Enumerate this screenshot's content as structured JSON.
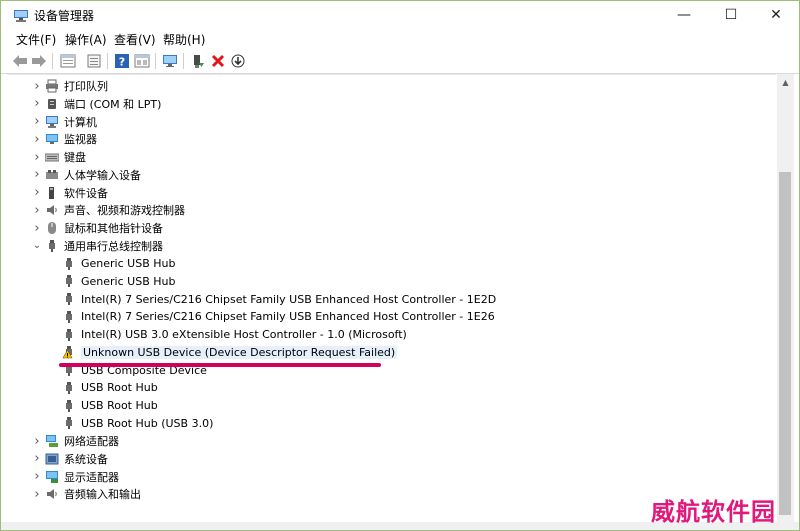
{
  "window": {
    "title": "设备管理器"
  },
  "winbuttons": {
    "minimize": "—",
    "maximize": "☐",
    "close": "✕"
  },
  "menu": [
    {
      "label": "文件(F)"
    },
    {
      "label": "操作(A)"
    },
    {
      "label": "查看(V)"
    },
    {
      "label": "帮助(H)"
    }
  ],
  "tree": [
    {
      "label": "打印队列",
      "icon": "printer-icon",
      "level": 0,
      "expander": "collapsed"
    },
    {
      "label": "端口 (COM 和 LPT)",
      "icon": "port-icon",
      "level": 0,
      "expander": "collapsed"
    },
    {
      "label": "计算机",
      "icon": "computer-icon",
      "level": 0,
      "expander": "collapsed"
    },
    {
      "label": "监视器",
      "icon": "monitor-icon",
      "level": 0,
      "expander": "collapsed"
    },
    {
      "label": "键盘",
      "icon": "keyboard-icon",
      "level": 0,
      "expander": "collapsed"
    },
    {
      "label": "人体学输入设备",
      "icon": "hid-icon",
      "level": 0,
      "expander": "collapsed"
    },
    {
      "label": "软件设备",
      "icon": "software-device-icon",
      "level": 0,
      "expander": "collapsed"
    },
    {
      "label": "声音、视频和游戏控制器",
      "icon": "speaker-icon",
      "level": 0,
      "expander": "collapsed"
    },
    {
      "label": "鼠标和其他指针设备",
      "icon": "mouse-icon",
      "level": 0,
      "expander": "collapsed"
    },
    {
      "label": "通用串行总线控制器",
      "icon": "usb-icon",
      "level": 0,
      "expander": "expanded"
    },
    {
      "label": "Generic USB Hub",
      "icon": "usb-icon",
      "level": 1
    },
    {
      "label": "Generic USB Hub",
      "icon": "usb-icon",
      "level": 1
    },
    {
      "label": "Intel(R) 7 Series/C216 Chipset Family USB Enhanced Host Controller - 1E2D",
      "icon": "usb-icon",
      "level": 1
    },
    {
      "label": "Intel(R) 7 Series/C216 Chipset Family USB Enhanced Host Controller - 1E26",
      "icon": "usb-icon",
      "level": 1
    },
    {
      "label": "Intel(R) USB 3.0 eXtensible Host Controller - 1.0 (Microsoft)",
      "icon": "usb-icon",
      "level": 1
    },
    {
      "label": "Unknown USB Device (Device Descriptor Request Failed)",
      "icon": "warning-icon",
      "level": 1,
      "selected": true
    },
    {
      "label": "USB Composite Device",
      "icon": "usb-icon",
      "level": 1
    },
    {
      "label": "USB Root Hub",
      "icon": "usb-icon",
      "level": 1
    },
    {
      "label": "USB Root Hub",
      "icon": "usb-icon",
      "level": 1
    },
    {
      "label": "USB Root Hub (USB 3.0)",
      "icon": "usb-icon",
      "level": 1
    },
    {
      "label": "网络适配器",
      "icon": "network-icon",
      "level": 0,
      "expander": "collapsed"
    },
    {
      "label": "系统设备",
      "icon": "system-device-icon",
      "level": 0,
      "expander": "collapsed"
    },
    {
      "label": "显示适配器",
      "icon": "display-adapter-icon",
      "level": 0,
      "expander": "collapsed"
    },
    {
      "label": "音频输入和输出",
      "icon": "audio-icon",
      "level": 0,
      "expander": "collapsed"
    }
  ],
  "watermark": {
    "text": "威航软件园"
  },
  "colors": {
    "highlight_underline": "#d1005a",
    "selection": "#e5f0fb",
    "watermark": "#e0197c"
  }
}
